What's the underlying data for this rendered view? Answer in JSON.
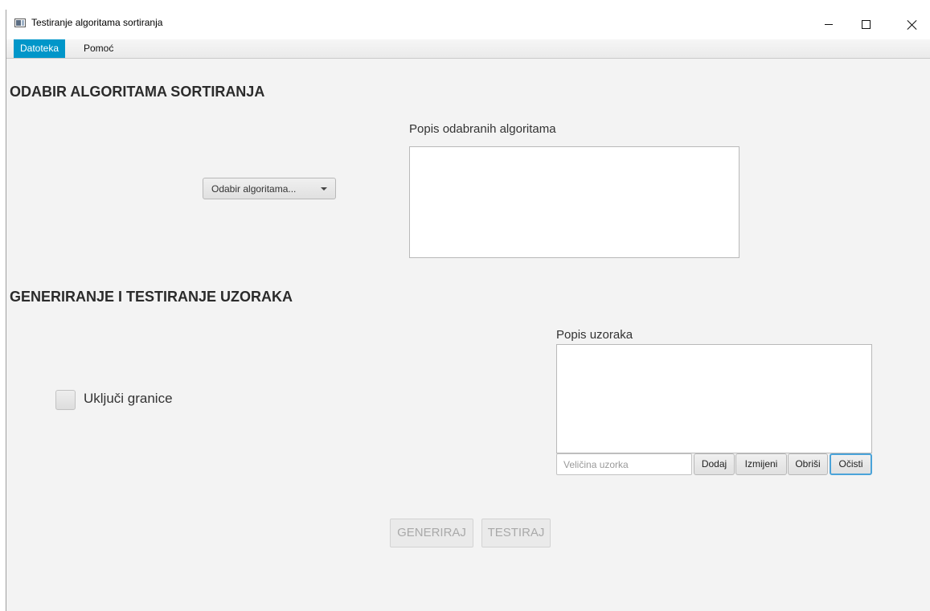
{
  "window": {
    "title": "Testiranje algoritama sortiranja"
  },
  "menu": {
    "items": [
      {
        "label": "Datoteka"
      },
      {
        "label": "Pomoć"
      }
    ]
  },
  "section_selection": {
    "title": "ODABIR ALGORITAMA SORTIRANJA",
    "combo_label": "Odabir algoritama...",
    "list_label": "Popis odabranih algoritama",
    "list_items": []
  },
  "section_samples": {
    "title": "GENERIRANJE I TESTIRANJE UZORAKA",
    "checkbox_label": "Uključi granice",
    "checkbox_checked": false,
    "list_label": "Popis uzoraka",
    "list_items": [],
    "size_input": {
      "value": "",
      "placeholder": "Veličina uzorka"
    },
    "buttons": {
      "add": "Dodaj",
      "edit": "Izmijeni",
      "delete": "Obriši",
      "clear": "Očisti"
    }
  },
  "actions": {
    "generate": "GENERIRAJ",
    "test": "TESTIRAJ"
  },
  "colors": {
    "accent": "#0096c9",
    "focus": "#4aa3d9",
    "background": "#f3f3f3"
  }
}
